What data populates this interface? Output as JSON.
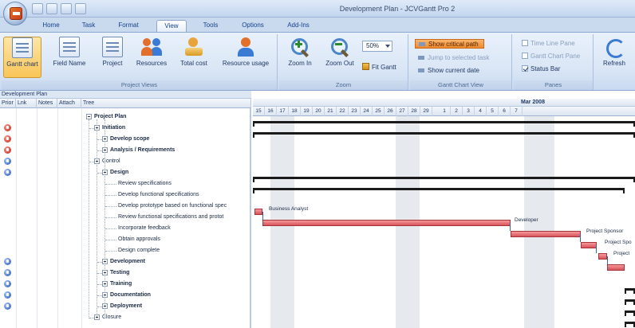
{
  "window": {
    "title": "Development Plan - JCVGantt Pro 2"
  },
  "tabs": [
    {
      "label": "Home",
      "active": false
    },
    {
      "label": "Task",
      "active": false
    },
    {
      "label": "Format",
      "active": false
    },
    {
      "label": "View",
      "active": true
    },
    {
      "label": "Tools",
      "active": false
    },
    {
      "label": "Options",
      "active": false
    },
    {
      "label": "Add-Ins",
      "active": false
    }
  ],
  "ribbon": {
    "project_views": {
      "caption": "Project Views",
      "buttons": [
        "Gantt chart",
        "Field Name",
        "Project",
        "Resources",
        "Total cost",
        "Resource usage"
      ]
    },
    "zoom": {
      "caption": "Zoom",
      "zoom_in": "Zoom In",
      "zoom_out": "Zoom Out",
      "zoom_value": "50%",
      "fit_gantt": "Fit Gantt"
    },
    "gantt_chart_view": {
      "caption": "Gantt Chart View",
      "show_critical_path": "Show critical path",
      "jump_to_selected": "Jump to selected task",
      "show_current_date": "Show current date"
    },
    "panes": {
      "caption": "Panes",
      "time_line_pane": "Time Line Pane",
      "gantt_chart_pane": "Gantt Chart Pane",
      "status_bar": "Status Bar"
    },
    "refresh": "Refresh"
  },
  "document": {
    "tab": "Development Plan",
    "columns": [
      "Prior",
      "Lnk",
      "Notes",
      "Attach",
      "Tree"
    ]
  },
  "timescale": {
    "month_label": "Mar 2008",
    "days": [
      "15",
      "16",
      "17",
      "18",
      "19",
      "20",
      "21",
      "22",
      "23",
      "24",
      "25",
      "26",
      "27",
      "28",
      "29",
      "1",
      "2",
      "3",
      "4",
      "5",
      "6",
      "7"
    ]
  },
  "tasks": [
    {
      "name": "Project Plan",
      "bold": true,
      "level": 0,
      "box": "minus",
      "status": ""
    },
    {
      "name": "Initiation",
      "bold": true,
      "level": 1,
      "box": "minus",
      "status": "red"
    },
    {
      "name": "Develop scope",
      "bold": true,
      "level": 2,
      "box": "plus",
      "status": "red"
    },
    {
      "name": "Analysis / Requirements",
      "bold": true,
      "level": 2,
      "box": "plus",
      "status": "red"
    },
    {
      "name": "Control",
      "bold": false,
      "level": 1,
      "box": "minus",
      "status": "blue"
    },
    {
      "name": "Design",
      "bold": true,
      "level": 2,
      "box": "minus",
      "status": "blue"
    },
    {
      "name": "Review specifications",
      "bold": false,
      "level": 3,
      "box": "",
      "status": ""
    },
    {
      "name": "Develop functional specifications",
      "bold": false,
      "level": 3,
      "box": "",
      "status": ""
    },
    {
      "name": "Develop prototype based on functional spec",
      "bold": false,
      "level": 3,
      "box": "",
      "status": ""
    },
    {
      "name": "Review functional specifications and protot",
      "bold": false,
      "level": 3,
      "box": "",
      "status": ""
    },
    {
      "name": "Incorporate feedback",
      "bold": false,
      "level": 3,
      "box": "",
      "status": ""
    },
    {
      "name": "Obtain approvals",
      "bold": false,
      "level": 3,
      "box": "",
      "status": ""
    },
    {
      "name": "Design complete",
      "bold": false,
      "level": 3,
      "box": "",
      "status": ""
    },
    {
      "name": "Development",
      "bold": true,
      "level": 2,
      "box": "plus",
      "status": "blue"
    },
    {
      "name": "Testing",
      "bold": true,
      "level": 2,
      "box": "plus",
      "status": "blue"
    },
    {
      "name": "Training",
      "bold": true,
      "level": 2,
      "box": "plus",
      "status": "blue"
    },
    {
      "name": "Documentation",
      "bold": true,
      "level": 2,
      "box": "plus",
      "status": "blue"
    },
    {
      "name": "Deployment",
      "bold": true,
      "level": 2,
      "box": "plus",
      "status": "blue"
    },
    {
      "name": "Closure",
      "bold": false,
      "level": 1,
      "box": "minus",
      "status": ""
    }
  ],
  "bar_labels": {
    "business_analyst": "Business Analyst",
    "developer": "Developer",
    "project_sponsor": "Project Sponsor",
    "project_sponsor_2": "Project Spo",
    "project_3": "Project"
  }
}
